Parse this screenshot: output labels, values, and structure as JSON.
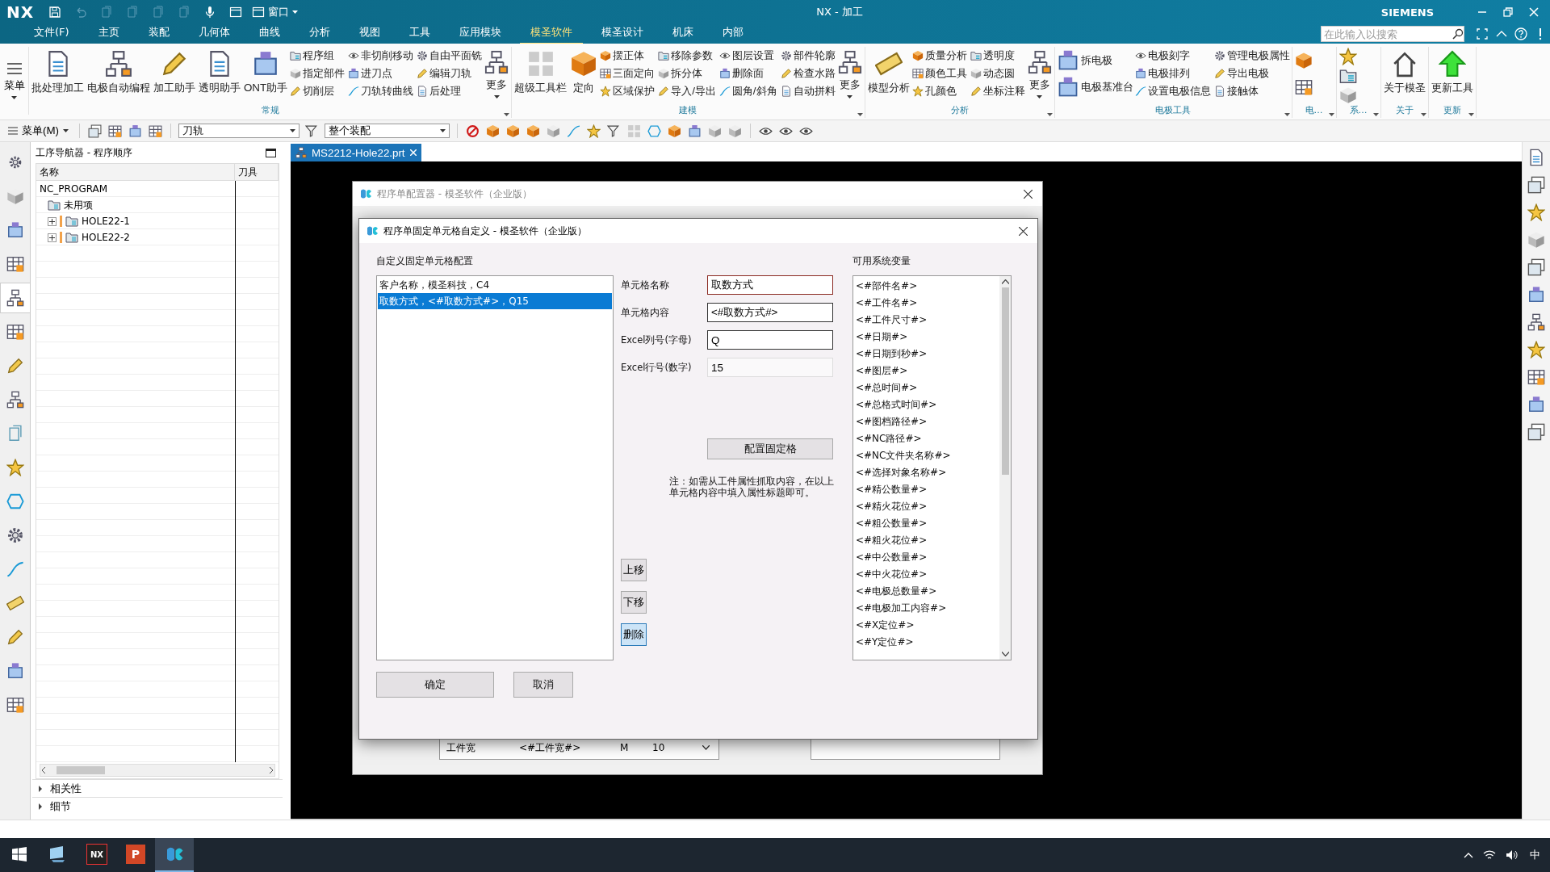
{
  "title_bar": {
    "logo": "NX",
    "window_menu": "窗口",
    "title": "NX - 加工",
    "brand": "SIEMENS",
    "search": {
      "placeholder": "在此输入以搜索"
    }
  },
  "menu_tabs": [
    {
      "label": "文件(F)",
      "selected": false
    },
    {
      "label": "主页",
      "selected": false
    },
    {
      "label": "装配",
      "selected": false
    },
    {
      "label": "几何体",
      "selected": false
    },
    {
      "label": "曲线",
      "selected": false
    },
    {
      "label": "分析",
      "selected": false
    },
    {
      "label": "视图",
      "selected": false
    },
    {
      "label": "工具",
      "selected": false
    },
    {
      "label": "应用模块",
      "selected": false
    },
    {
      "label": "模圣软件",
      "selected": true
    },
    {
      "label": "模圣设计",
      "selected": false
    },
    {
      "label": "机床",
      "selected": false
    },
    {
      "label": "内部",
      "selected": false
    }
  ],
  "ribbon": {
    "menu_button": "菜单",
    "groups": [
      {
        "title": "常规",
        "items": [
          {
            "kind": "large",
            "label": "批处理加工"
          },
          {
            "kind": "large",
            "label": "电极自动编程"
          },
          {
            "kind": "large",
            "label": "加工助手"
          },
          {
            "kind": "large",
            "label": "透明助手"
          },
          {
            "kind": "large",
            "label": "ONT助手"
          },
          {
            "kind": "small",
            "label": "程序组"
          },
          {
            "kind": "small",
            "label": "指定部件"
          },
          {
            "kind": "small",
            "label": "切削层"
          },
          {
            "kind": "small",
            "label": "非切削移动"
          },
          {
            "kind": "small",
            "label": "进刀点"
          },
          {
            "kind": "small",
            "label": "刀轨转曲线"
          },
          {
            "kind": "small",
            "label": "自由平面铣"
          },
          {
            "kind": "small",
            "label": "编辑刀轨"
          },
          {
            "kind": "small",
            "label": "后处理"
          },
          {
            "kind": "more",
            "label": "更多"
          }
        ]
      },
      {
        "title": "建模",
        "items": [
          {
            "kind": "large",
            "label": "超级工具栏"
          },
          {
            "kind": "large",
            "label": "定向"
          },
          {
            "kind": "small",
            "label": "摆正体"
          },
          {
            "kind": "small",
            "label": "三面定向"
          },
          {
            "kind": "small",
            "label": "区域保护"
          },
          {
            "kind": "small",
            "label": "移除参数"
          },
          {
            "kind": "small",
            "label": "拆分体"
          },
          {
            "kind": "small",
            "label": "导入/导出"
          },
          {
            "kind": "small",
            "label": "图层设置"
          },
          {
            "kind": "small",
            "label": "删除面"
          },
          {
            "kind": "small",
            "label": "圆角/斜角"
          },
          {
            "kind": "small",
            "label": "部件轮廓"
          },
          {
            "kind": "small",
            "label": "检查水路"
          },
          {
            "kind": "small",
            "label": "自动拼料"
          },
          {
            "kind": "more",
            "label": "更多"
          }
        ]
      },
      {
        "title": "分析",
        "items": [
          {
            "kind": "large",
            "label": "模型分析"
          },
          {
            "kind": "small",
            "label": "质量分析"
          },
          {
            "kind": "small",
            "label": "颜色工具"
          },
          {
            "kind": "small",
            "label": "孔颜色"
          },
          {
            "kind": "small",
            "label": "透明度"
          },
          {
            "kind": "small",
            "label": "动态圆"
          },
          {
            "kind": "small",
            "label": "坐标注释"
          },
          {
            "kind": "more",
            "label": "更多"
          }
        ]
      },
      {
        "title": "电极工具",
        "items": [
          {
            "kind": "medium",
            "label": "拆电极"
          },
          {
            "kind": "medium",
            "label": "电极基准台"
          },
          {
            "kind": "small",
            "label": "电极刻字"
          },
          {
            "kind": "small",
            "label": "电极排列"
          },
          {
            "kind": "small",
            "label": "设置电极信息"
          },
          {
            "kind": "small",
            "label": "管理电极属性"
          },
          {
            "kind": "small",
            "label": "导出电极"
          },
          {
            "kind": "small",
            "label": "接触体"
          }
        ]
      },
      {
        "title": "电…",
        "items": [
          {
            "kind": "icon"
          },
          {
            "kind": "icon"
          }
        ]
      },
      {
        "title": "系…",
        "items": [
          {
            "kind": "icon"
          },
          {
            "kind": "icon"
          },
          {
            "kind": "icon"
          }
        ]
      },
      {
        "title": "关于",
        "items": [
          {
            "kind": "large",
            "label": "关于模圣"
          }
        ]
      },
      {
        "title": "更新",
        "items": [
          {
            "kind": "large",
            "label": "更新工具"
          }
        ]
      }
    ]
  },
  "toolbar": {
    "menu": "菜单(M)",
    "selection_filter": "刀轨",
    "scope": "整个装配"
  },
  "resource_tabs": [
    {
      "selected": false
    },
    {
      "selected": false
    },
    {
      "selected": false
    },
    {
      "selected": true
    },
    {
      "selected": false
    },
    {
      "selected": false
    },
    {
      "selected": false
    },
    {
      "selected": false
    },
    {
      "selected": false
    },
    {
      "selected": false
    },
    {
      "selected": false
    },
    {
      "selected": false
    },
    {
      "selected": false
    },
    {
      "selected": false
    },
    {
      "selected": false
    },
    {
      "selected": false
    }
  ],
  "navigator": {
    "title": "工序导航器 - 程序顺序",
    "columns": [
      "名称",
      "刀具"
    ],
    "tree": [
      {
        "label": "NC_PROGRAM",
        "children": [
          {
            "label": "未用项"
          },
          {
            "label": "HOLE22-1",
            "expanded": false
          },
          {
            "label": "HOLE22-2",
            "expanded": false
          }
        ]
      }
    ],
    "sections": [
      {
        "label": "相关性",
        "expanded": false
      },
      {
        "label": "细节",
        "expanded": false
      }
    ]
  },
  "document_tab": {
    "label": "MS2212-Hole22.prt"
  },
  "config_dialog": {
    "title": "程序单配置器 - 模圣软件（企业版）",
    "table_row": [
      "工件宽",
      "<#工件宽#>",
      "M",
      "10"
    ]
  },
  "cell_dialog": {
    "title": "程序单固定单元格自定义 - 模圣软件（企业版）",
    "list_label": "自定义固定单元格配置",
    "cells": [
      {
        "label": "客户名称，模圣科技，C4",
        "selected": false
      },
      {
        "label": "取数方式，<#取数方式#>，Q15",
        "selected": true
      }
    ],
    "fields": [
      {
        "label": "单元格名称",
        "value": "取数方式",
        "focused": true,
        "disabled": false
      },
      {
        "label": "单元格内容",
        "value": "<#取数方式#>",
        "focused": false,
        "disabled": false
      },
      {
        "label": "Excel列号(字母)",
        "value": "Q",
        "focused": false,
        "disabled": false
      },
      {
        "label": "Excel行号(数字)",
        "value": "15",
        "focused": false,
        "disabled": true
      }
    ],
    "configure_button": "配置固定格",
    "note": "注：如需从工件属性抓取内容，在以上单元格内容中填入属性标题即可。",
    "move_buttons": [
      {
        "label": "上移",
        "hovered": false
      },
      {
        "label": "下移",
        "hovered": false
      },
      {
        "label": "删除",
        "hovered": true
      }
    ],
    "variables_label": "可用系统变量",
    "variables": [
      "<#部件名#>",
      "<#工件名#>",
      "<#工件尺寸#>",
      "<#日期#>",
      "<#日期到秒#>",
      "<#图层#>",
      "<#总时间#>",
      "<#总格式时间#>",
      "<#图档路径#>",
      "<#NC路径#>",
      "<#NC文件夹名称#>",
      "<#选择对象名称#>",
      "<#精公数量#>",
      "<#精火花位#>",
      "<#粗公数量#>",
      "<#粗火花位#>",
      "<#中公数量#>",
      "<#中火花位#>",
      "<#电极总数量#>",
      "<#电极加工内容#>",
      "<#X定位#>",
      "<#Y定位#>"
    ],
    "ok": "确定",
    "cancel": "取消"
  },
  "taskbar": {
    "apps": [
      {
        "kind": "explorer",
        "selected": false
      },
      {
        "kind": "nx",
        "glyph": "NX",
        "selected": false
      },
      {
        "kind": "slides",
        "glyph": "P",
        "selected": false
      },
      {
        "kind": "ms",
        "selected": true
      }
    ],
    "ime": "中"
  }
}
